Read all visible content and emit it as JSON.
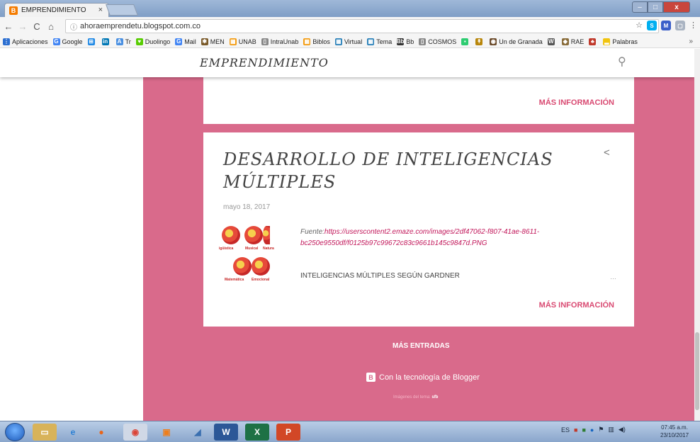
{
  "browser": {
    "tab_title": "EMPRENDIMIENTO",
    "tab_close": "×",
    "url": "ahoraemprendetu.blogspot.com.co",
    "window_controls": {
      "minimize": "–",
      "maximize": "□",
      "close": "x"
    }
  },
  "bookmarks": [
    {
      "label": "Aplicaciones",
      "color": "#2c6fd1",
      "glyph": "⋮"
    },
    {
      "label": "Google",
      "color": "#4285f4",
      "glyph": "G"
    },
    {
      "label": "",
      "color": "#1e88e5",
      "glyph": "⊞"
    },
    {
      "label": "",
      "color": "#0077b5",
      "glyph": "in"
    },
    {
      "label": "Tr",
      "color": "#4a90e2",
      "glyph": "A"
    },
    {
      "label": "Duolingo",
      "color": "#58cc02",
      "glyph": "♥"
    },
    {
      "label": "Mail",
      "color": "#4285f4",
      "glyph": "G"
    },
    {
      "label": "MEN",
      "color": "#7a5a2a",
      "glyph": "✱"
    },
    {
      "label": "UNAB",
      "color": "#f39c12",
      "glyph": "▦"
    },
    {
      "label": "IntraUnab",
      "color": "#888888",
      "glyph": "▯"
    },
    {
      "label": "Biblos",
      "color": "#f39c12",
      "glyph": "▦"
    },
    {
      "label": "Virtual",
      "color": "#2980b9",
      "glyph": "▦"
    },
    {
      "label": "Tema",
      "color": "#2980b9",
      "glyph": "▦"
    },
    {
      "label": "Bb",
      "color": "#333333",
      "glyph": "Bb"
    },
    {
      "label": "COSMOS",
      "color": "#888888",
      "glyph": "▯"
    },
    {
      "label": "",
      "color": "#2ecc71",
      "glyph": "▪"
    },
    {
      "label": "",
      "color": "#b8860b",
      "glyph": "↟"
    },
    {
      "label": "Un de Granada",
      "color": "#6b4a2a",
      "glyph": "◉"
    },
    {
      "label": "",
      "color": "#555555",
      "glyph": "W"
    },
    {
      "label": "RAE",
      "color": "#8a6d3b",
      "glyph": "◆"
    },
    {
      "label": "",
      "color": "#c0392b",
      "glyph": "♣"
    },
    {
      "label": "Palabras",
      "color": "#f1c40f",
      "glyph": "▂"
    }
  ],
  "bookmarks_more": "»",
  "blog": {
    "title": "EMPRENDIMIENTO",
    "more_info_1": "MÁS INFORMACIÓN",
    "post": {
      "title": "DESARROLLO DE INTELIGENCIAS MÚLTIPLES",
      "date": "mayo 18, 2017",
      "source_prefix": "Fuente:",
      "source_url": "https://userscontent2.emaze.com/images/2df47062-f807-41ae-8611-bc250e9550df/f0125b97c99672c83c9661b145c9847d.PNG",
      "excerpt": "INTELIGENCIAS MÚLTIPLES SEGÚN GARDNER",
      "ellipsis": "…",
      "more_info": "MÁS INFORMACIÓN",
      "thumb_labels": [
        "igüística",
        "Musical",
        "Natura",
        "Matemática",
        "Emocional"
      ]
    },
    "more_entries": "MÁS ENTRADAS",
    "powered_by": "Con la tecnología de Blogger",
    "credits_prefix": "Imágenes del tema:",
    "credits_name": "sfb"
  },
  "taskbar": {
    "language": "ES",
    "time": "07:45 a.m.",
    "date": "23/10/2017"
  },
  "colors": {
    "accent_pink": "#d96a8b",
    "link_pink": "#c2185b",
    "button_pink": "#d94a72"
  }
}
